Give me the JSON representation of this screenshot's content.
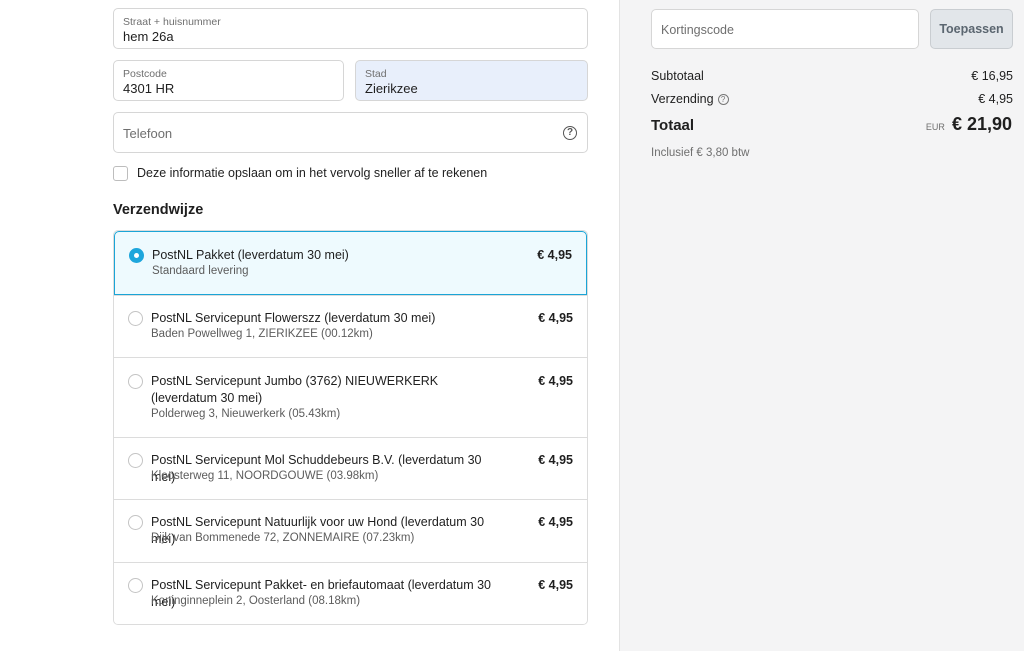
{
  "address": {
    "street": {
      "label": "Straat + huisnummer",
      "value": "hem 26a"
    },
    "postcode": {
      "label": "Postcode",
      "value": "4301 HR"
    },
    "city": {
      "label": "Stad",
      "value": "Zierikzee"
    },
    "phone": {
      "placeholder": "Telefoon"
    },
    "save_info_label": "Deze informatie opslaan om in het vervolg sneller af te rekenen"
  },
  "shipping": {
    "title": "Verzendwijze",
    "methods": [
      {
        "name": "PostNL Pakket (leverdatum 30 mei)",
        "detail": "Standaard levering",
        "price": "€ 4,95",
        "selected": true
      },
      {
        "name": "PostNL Servicepunt Flowerszz (leverdatum 30 mei)",
        "detail": "Baden Powellweg 1, ZIERIKZEE (00.12km)",
        "price": "€ 4,95",
        "selected": false
      },
      {
        "name": "PostNL Servicepunt Jumbo (3762) NIEUWERKERK (leverdatum 30 mei)",
        "detail": "Polderweg 3, Nieuwerkerk (05.43km)",
        "price": "€ 4,95",
        "selected": false
      },
      {
        "name": "PostNL Servicepunt Mol Schuddebeurs B.V. (leverdatum 30 mei)",
        "detail": "Kloosterweg 11, NOORDGOUWE (03.98km)",
        "price": "€ 4,95",
        "selected": false
      },
      {
        "name": "PostNL Servicepunt Natuurlijk voor uw Hond (leverdatum 30 mei)",
        "detail": "Dijk van Bommenede 72, ZONNEMAIRE (07.23km)",
        "price": "€ 4,95",
        "selected": false
      },
      {
        "name": "PostNL Servicepunt Pakket- en briefautomaat (leverdatum 30 mei)",
        "detail": "Koninginneplein 2, Oosterland (08.18km)",
        "price": "€ 4,95",
        "selected": false
      }
    ]
  },
  "summary": {
    "discount_placeholder": "Kortingscode",
    "apply_label": "Toepassen",
    "subtotal_label": "Subtotaal",
    "subtotal_value": "€ 16,95",
    "shipping_label": "Verzending",
    "shipping_value": "€ 4,95",
    "total_label": "Totaal",
    "currency": "EUR",
    "total_value": "€ 21,90",
    "tax_note": "Inclusief € 3,80 btw"
  },
  "colors": {
    "accent": "#1ea6dc",
    "selected_bg": "#eefafe",
    "autofill_bg": "#e8effb",
    "sidebar_bg": "#f4f4f5"
  },
  "icons": {
    "phone_help": "question-circle-icon",
    "shipping_info": "question-circle-icon"
  }
}
